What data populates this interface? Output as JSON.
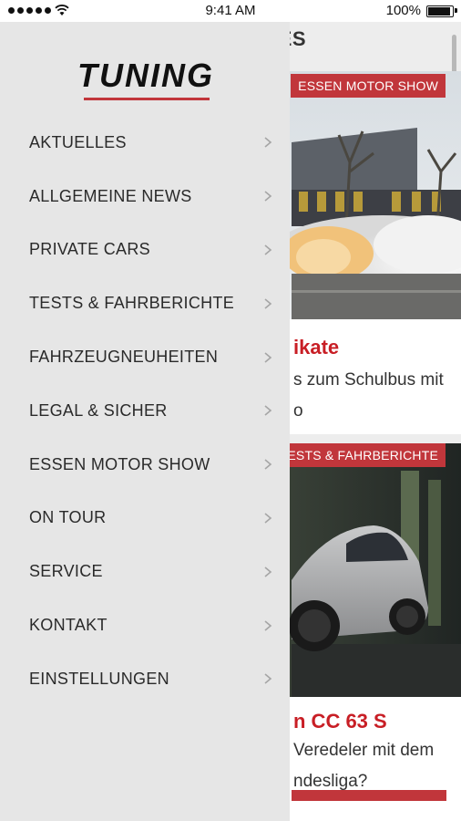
{
  "status_bar": {
    "time": "9:41 AM",
    "battery": "100%",
    "battery_level": 1.0
  },
  "background": {
    "header_title": "ES",
    "cards": [
      {
        "badge": "ESSEN MOTOR SHOW",
        "title": "ikate",
        "teaser_line1": "s zum Schulbus mit",
        "teaser_line2": "o"
      },
      {
        "badge": "TESTS & FAHRBERICHTE",
        "title": "n CC 63 S",
        "teaser_line1": "Veredeler mit dem",
        "teaser_line2": "ndesliga?"
      }
    ]
  },
  "drawer": {
    "logo_text": "TUNING",
    "menu_items": [
      {
        "label": "AKTUELLES"
      },
      {
        "label": "ALLGEMEINE NEWS"
      },
      {
        "label": "PRIVATE CARS"
      },
      {
        "label": "TESTS & FAHRBERICHTE"
      },
      {
        "label": "FAHRZEUGNEUHEITEN"
      },
      {
        "label": "LEGAL & SICHER"
      },
      {
        "label": "ESSEN MOTOR SHOW"
      },
      {
        "label": "ON TOUR"
      },
      {
        "label": "SERVICE"
      },
      {
        "label": "KONTAKT"
      },
      {
        "label": "EINSTELLUNGEN"
      }
    ]
  },
  "colors": {
    "accent": "#c1363b",
    "title_red": "#c81e25",
    "drawer_bg": "#e6e6e6"
  }
}
